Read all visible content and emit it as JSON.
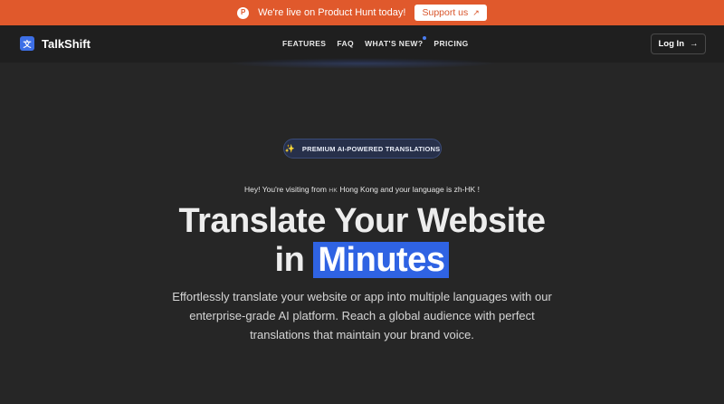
{
  "announcement": {
    "badge": "P",
    "text": "We're live on Product Hunt today!",
    "button_label": "Support us",
    "button_icon": "↗"
  },
  "nav": {
    "logo_mark": "文",
    "brand": "TalkShift",
    "links": [
      "FEATURES",
      "FAQ",
      "WHAT'S NEW?",
      "PRICING"
    ],
    "login_label": "Log In",
    "login_icon": "→"
  },
  "hero": {
    "pill_icon": "✨",
    "pill_text": "PREMIUM AI-POWERED TRANSLATIONS",
    "visitor_prefix": "Hey! You're visiting from",
    "visitor_flag": "HK",
    "visitor_country": "Hong Kong",
    "visitor_middle": "and your language is",
    "visitor_language": "zh-HK",
    "visitor_suffix": "!",
    "headline_line1": "Translate Your Website",
    "headline_in": "in",
    "headline_highlight": "Minutes",
    "subtext": "Effortlessly translate your website or app into multiple languages with our enterprise-grade AI platform. Reach a global audience with perfect translations that maintain your brand voice."
  },
  "colors": {
    "accent": "#2f63e3",
    "announcement": "#e0592c",
    "background": "#262626"
  }
}
